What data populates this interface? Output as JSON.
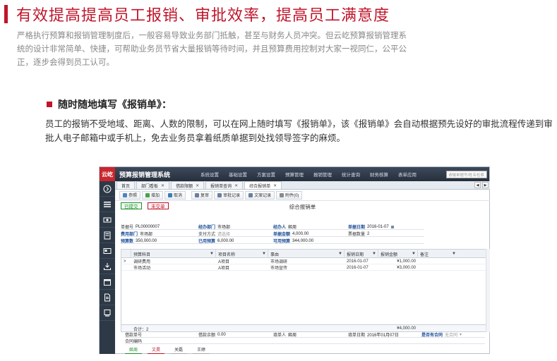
{
  "article": {
    "headline": "有效提高提高员工报销、审批效率，提高员工满意度",
    "intro": "严格执行预算和报销管理制度后，一般容易导致业务部门抵触，甚至与财务人员冲突。但云屹预算报销管理系统的设计非常简单、快捷，可帮助业务员节省大量报销等待时间，并且预算费用控制对大家一视同仁，公平公正，逐步会得到员工认可。",
    "subtitle": "随时随地填写《报销单》：",
    "body": "员工的报销不受地域、距离、人数的限制，可以在网上随时填写《报销单》，该《报销单》会自动根据预先设好的审批流程传递到审批人电子邮箱中或手机上，免去业务员拿着纸质单据到处找领导签字的麻烦。"
  },
  "app": {
    "logo": "云屹",
    "title": "预算报销管理系统",
    "menu": [
      "系统设置",
      "基础设置",
      "方案设置",
      "预算管理",
      "报销管理",
      "统计查询",
      "财务核算",
      "表单应用"
    ],
    "search_placeholder": "请输单据号/姓名检索",
    "tabs": [
      {
        "label": "首页",
        "closable": false
      },
      {
        "label": "部门看板",
        "closable": true
      },
      {
        "label": "借款限额",
        "closable": true
      },
      {
        "label": "报销单查询",
        "closable": true
      },
      {
        "label": "综合报销单",
        "closable": true,
        "active": true
      }
    ],
    "toolbar": {
      "ref": "参照",
      "add": "增加",
      "cancel": "取消",
      "audit": "复审",
      "audit_log": "审批记录",
      "doc_log": "文案记录",
      "attach": "附件(0)"
    },
    "status": {
      "submitted": "已提交",
      "not_delivered": "未交单"
    },
    "form_title": "综合报销单",
    "fields": {
      "doc_no_label": "单据号",
      "doc_no": "PL00000007",
      "dept_label": "经办部门",
      "dept": "市场部",
      "handler_label": "经办人",
      "handler": "姬周",
      "date_label": "单据日期",
      "date": "2016-01-07",
      "cost_dept_label": "费用部门",
      "cost_dept": "市场部",
      "pay_label": "支付方式",
      "pay": "请选择",
      "amount_label": "单据金额",
      "amount": "4,000.00",
      "bill_count_label": "票据数量",
      "bill_count": "2",
      "budget_label": "预算数",
      "budget": "350,000.00",
      "used_label": "已用预算",
      "used": "6,000.00",
      "available_label": "可用预算",
      "available": "344,000.00"
    },
    "grid": {
      "headers": [
        "预算科目",
        "项目名称",
        "事由",
        "报销日期",
        "报销金额",
        "备注"
      ],
      "rows": [
        {
          "marker": ">",
          "subject": "调研费用",
          "project": "A项目",
          "reason": "市场调研",
          "date": "2016-01-07",
          "amount": "¥1,000.00",
          "note": ""
        },
        {
          "marker": "",
          "subject": "市场活动",
          "project": "A项目",
          "reason": "市场宣传",
          "date": "2016-01-07",
          "amount": "¥3,000.00",
          "note": ""
        }
      ],
      "total_label": "合计：2",
      "total_amount": "¥4,000.00"
    },
    "footer": {
      "loan_no_label": "借款单号",
      "loan_balance_label": "借款余额",
      "loan_balance": "0.00",
      "filler_label": "填单人",
      "filler": "姬周",
      "fill_date_label": "填单日期",
      "fill_date": "2016年01月07日",
      "contract_label": "是否有合同",
      "contract": "无合同",
      "contract_no_label": "合同编码"
    },
    "flow": [
      "姬周",
      "文昊",
      "关磊",
      "王婷"
    ]
  }
}
